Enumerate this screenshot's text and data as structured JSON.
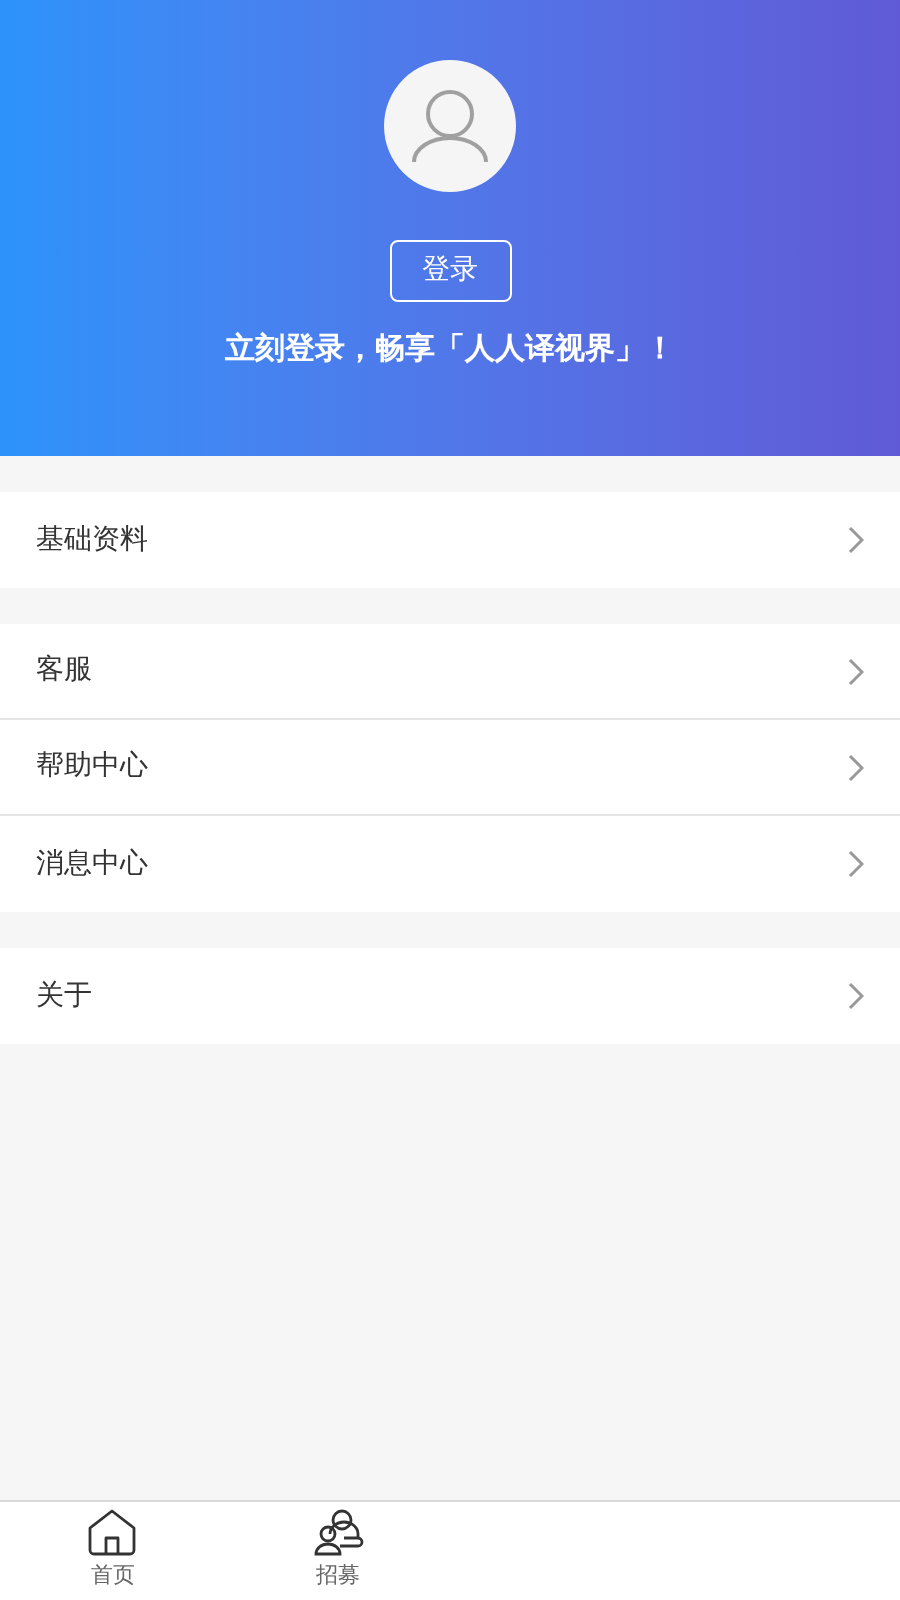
{
  "header": {
    "login_button": "登录",
    "tagline": "立刻登录，畅享「人人译视界」！"
  },
  "menu_groups": [
    {
      "items": [
        {
          "label": "基础资料"
        }
      ]
    },
    {
      "items": [
        {
          "label": "客服"
        },
        {
          "label": "帮助中心"
        },
        {
          "label": "消息中心"
        }
      ]
    },
    {
      "items": [
        {
          "label": "关于"
        }
      ]
    }
  ],
  "tab_bar": [
    {
      "label": "首页",
      "kind": "home"
    },
    {
      "label": "招募",
      "kind": "people"
    }
  ]
}
